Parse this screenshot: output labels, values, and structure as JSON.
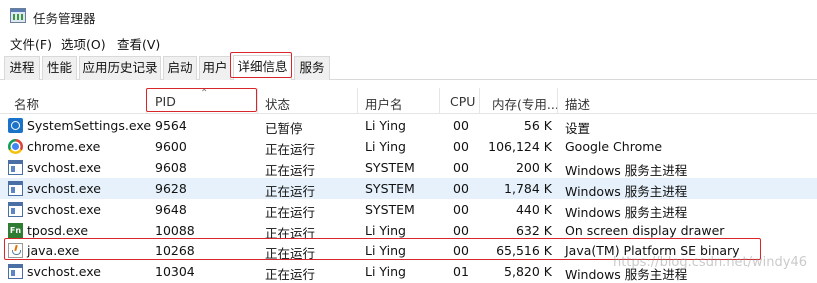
{
  "window": {
    "title": "任务管理器"
  },
  "menu": [
    "文件(F)",
    "选项(O)",
    "查看(V)"
  ],
  "tabs": [
    "进程",
    "性能",
    "应用历史记录",
    "启动",
    "用户",
    "详细信息",
    "服务"
  ],
  "active_tab": "详细信息",
  "columns": {
    "name": "名称",
    "pid": "PID",
    "status": "状态",
    "user": "用户名",
    "cpu": "CPU",
    "memory": "内存(专用...",
    "desc": "描述"
  },
  "rows": [
    {
      "icon": "settings-icon",
      "name": "SystemSettings.exe",
      "pid": "9564",
      "status": "已暂停",
      "user": "Li Ying",
      "cpu": "00",
      "memory": "56 K",
      "desc": "设置"
    },
    {
      "icon": "chrome-icon",
      "name": "chrome.exe",
      "pid": "9600",
      "status": "正在运行",
      "user": "Li Ying",
      "cpu": "00",
      "memory": "106,124 K",
      "desc": "Google Chrome"
    },
    {
      "icon": "svchost-icon",
      "name": "svchost.exe",
      "pid": "9608",
      "status": "正在运行",
      "user": "SYSTEM",
      "cpu": "00",
      "memory": "200 K",
      "desc": "Windows 服务主进程"
    },
    {
      "icon": "svchost-icon",
      "name": "svchost.exe",
      "pid": "9628",
      "status": "正在运行",
      "user": "SYSTEM",
      "cpu": "00",
      "memory": "1,784 K",
      "desc": "Windows 服务主进程"
    },
    {
      "icon": "svchost-icon",
      "name": "svchost.exe",
      "pid": "9648",
      "status": "正在运行",
      "user": "SYSTEM",
      "cpu": "00",
      "memory": "440 K",
      "desc": "Windows 服务主进程"
    },
    {
      "icon": "tposd-icon",
      "name": "tposd.exe",
      "pid": "10088",
      "status": "正在运行",
      "user": "Li Ying",
      "cpu": "00",
      "memory": "632 K",
      "desc": "On screen display drawer"
    },
    {
      "icon": "java-icon",
      "name": "java.exe",
      "pid": "10268",
      "status": "正在运行",
      "user": "Li Ying",
      "cpu": "00",
      "memory": "65,516 K",
      "desc": "Java(TM) Platform SE binary"
    },
    {
      "icon": "svchost-icon",
      "name": "svchost.exe",
      "pid": "10304",
      "status": "正在运行",
      "user": "Li Ying",
      "cpu": "01",
      "memory": "5,820 K",
      "desc": "Windows 服务主进程"
    }
  ],
  "selected_row": 3,
  "tposd_icon_text": "Fn",
  "watermark": "https://blog.csdn.net/windy46"
}
